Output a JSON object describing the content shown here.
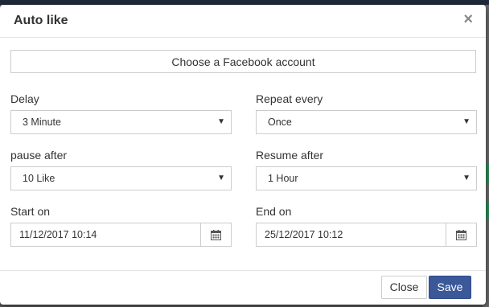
{
  "dialog": {
    "title": "Auto like",
    "close_glyph": "×",
    "account_button": "Choose a Facebook account"
  },
  "form": {
    "delay": {
      "label": "Delay",
      "value": "3 Minute"
    },
    "repeat": {
      "label": "Repeat every",
      "value": "Once"
    },
    "pause": {
      "label": "pause after",
      "value": "10 Like"
    },
    "resume": {
      "label": "Resume after",
      "value": "1 Hour"
    },
    "start": {
      "label": "Start on",
      "value": "11/12/2017 10:14"
    },
    "end": {
      "label": "End on",
      "value": "25/12/2017 10:12"
    }
  },
  "footer": {
    "close_label": "Close",
    "save_label": "Save"
  },
  "icons": {
    "caret": "caret-down-icon",
    "calendar": "calendar-icon"
  },
  "colors": {
    "save_bg": "#3b5998",
    "backdrop": "#5b5b5b"
  }
}
